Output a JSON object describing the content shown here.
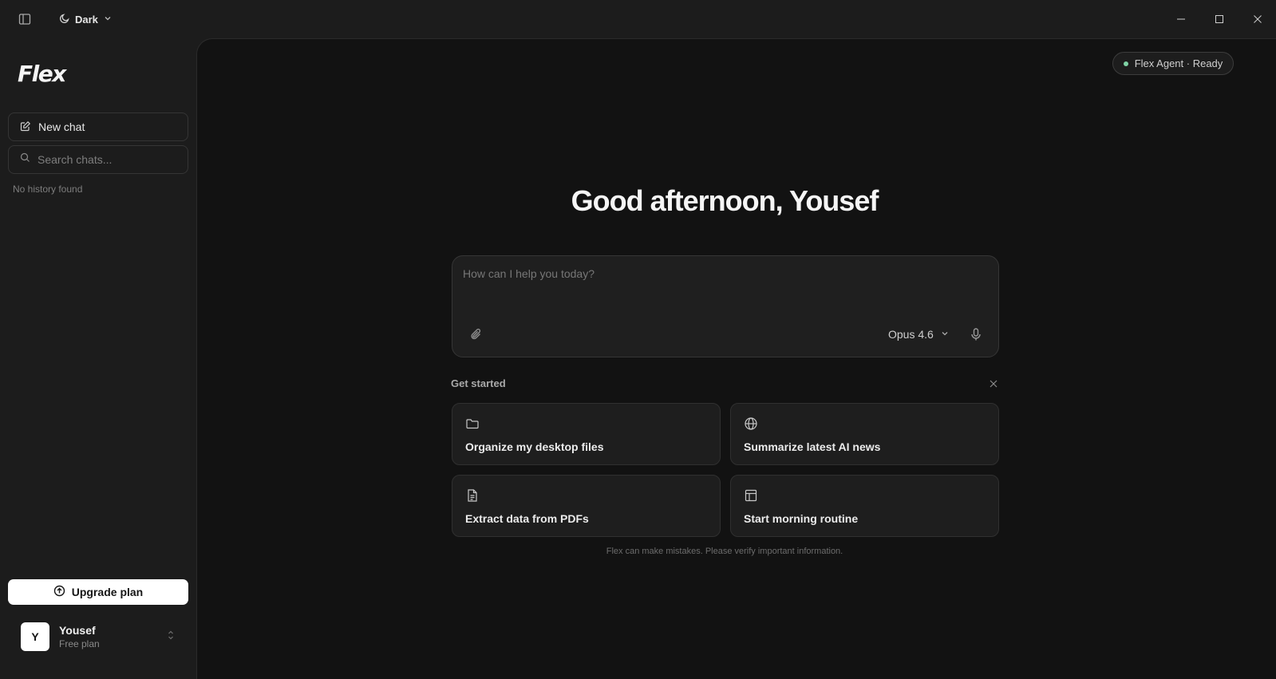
{
  "titlebar": {
    "theme_label": "Dark",
    "icons": [
      "sidebar-toggle-icon",
      "moon-icon",
      "chevron-down-icon",
      "minimize-icon",
      "maximize-icon",
      "close-icon"
    ]
  },
  "sidebar": {
    "logo": "Flex",
    "new_chat_label": "New chat",
    "search_placeholder": "Search chats...",
    "empty_history": "No history found",
    "upgrade_label": "Upgrade plan",
    "user": {
      "initial": "Y",
      "name": "Yousef",
      "plan": "Free plan"
    }
  },
  "main": {
    "agent_status": "Flex Agent · Ready",
    "greeting": "Good afternoon, Yousef",
    "composer": {
      "placeholder": "How can I help you today?",
      "model": "Opus 4.6"
    },
    "get_started": {
      "title": "Get started",
      "cards": [
        {
          "label": "Organize my desktop files",
          "icon": "folder-icon"
        },
        {
          "label": "Summarize latest AI news",
          "icon": "globe-icon"
        },
        {
          "label": "Extract data from PDFs",
          "icon": "file-text-icon"
        },
        {
          "label": "Start morning routine",
          "icon": "layout-icon"
        }
      ]
    },
    "disclaimer": "Flex can make mistakes. Please verify important information."
  },
  "colors": {
    "sidebar_bg": "#1c1c1c",
    "main_bg": "#121212",
    "card_bg": "#1e1e1e",
    "status_dot": "#7fd3a5",
    "upgrade_bg": "#ffffff"
  }
}
